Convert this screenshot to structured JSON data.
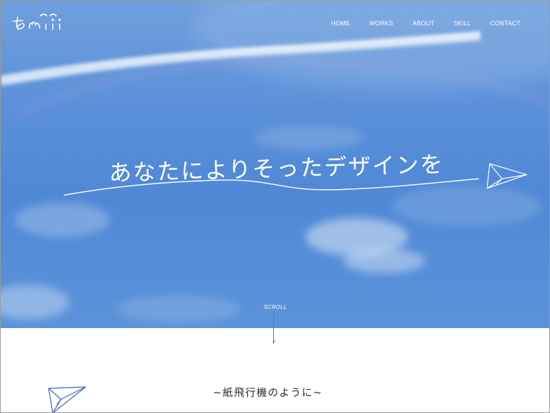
{
  "header": {
    "logo_icon": "handwritten-logo-icon",
    "logo_text": "smii",
    "nav": [
      {
        "label": "HOME"
      },
      {
        "label": "WORKS"
      },
      {
        "label": "ABOUT"
      },
      {
        "label": "SKILL"
      },
      {
        "label": "CONTACT"
      }
    ]
  },
  "hero": {
    "tagline": "あなたによりそったデザインを",
    "plane_icon": "paper-plane-icon",
    "scroll_label": "SCROLL",
    "colors": {
      "sky": "#5a8fd9",
      "scroll_line": "#4a6fd0"
    }
  },
  "section": {
    "title": "~紙飛行機のように~",
    "plane_icon": "paper-plane-icon"
  }
}
